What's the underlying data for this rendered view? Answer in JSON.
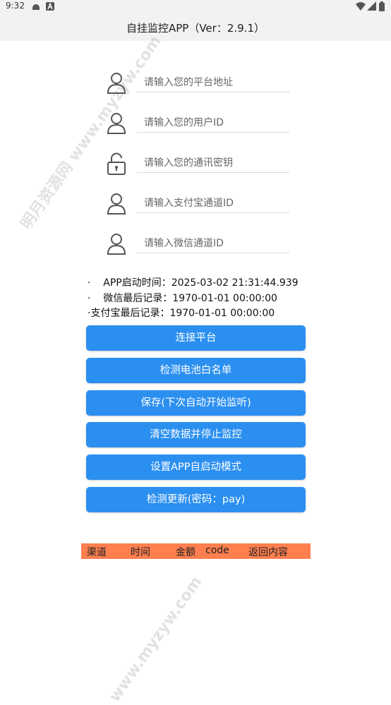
{
  "status_bar": {
    "time": "9:32",
    "icons": [
      "android-icon",
      "a-badge-icon",
      "wifi-icon",
      "signal-icon",
      "battery-icon"
    ]
  },
  "app_bar": {
    "title": "自挂监控APP（Ver：2.9.1）"
  },
  "fields": [
    {
      "placeholder": "请输入您的平台地址",
      "icon": "person-icon"
    },
    {
      "placeholder": "请输入您的用户ID",
      "icon": "person-icon"
    },
    {
      "placeholder": "请输入您的通讯密钥",
      "icon": "unlock-icon"
    },
    {
      "placeholder": "请输入支付宝通道ID",
      "icon": "person-icon"
    },
    {
      "placeholder": "请输入微信通道ID",
      "icon": "person-icon"
    }
  ],
  "info": {
    "line1": "·    APP启动时间：2025-03-02 21:31:44.939",
    "line2": "·    微信最后记录：1970-01-01 00:00:00",
    "line3": "·支付宝最后记录：1970-01-01 00:00:00"
  },
  "buttons": {
    "connect": "连接平台",
    "battery": "检测电池白名单",
    "save": "保存(下次自动开始监听)",
    "clear": "清空数据并停止监控",
    "autostart": "设置APP自启动模式",
    "update": "检测更新(密码：pay)"
  },
  "table": {
    "headers": [
      "渠道",
      "时间",
      "金额",
      "code",
      "返回内容"
    ],
    "header_color": "#ff7f4f"
  },
  "watermarks": {
    "top": "明月资源网 www.myzyw.com",
    "bottom": "www.myzyw.com"
  },
  "colors": {
    "accent": "#2b8ff0",
    "bar": "#f2f2f2"
  }
}
